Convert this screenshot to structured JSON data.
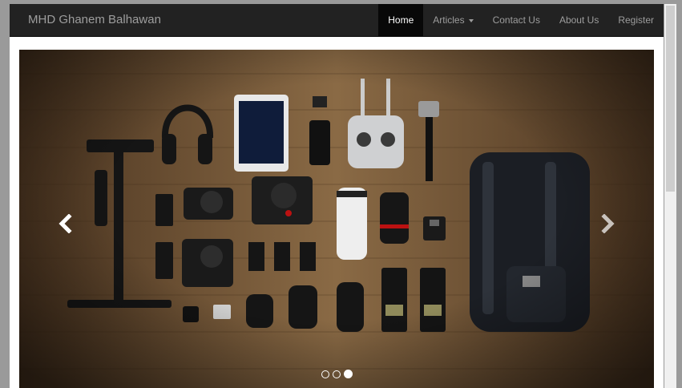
{
  "navbar": {
    "brand": "MHD Ghanem Balhawan",
    "items": [
      {
        "label": "Home",
        "active": true
      },
      {
        "label": "Articles",
        "dropdown": true
      },
      {
        "label": "Contact Us"
      },
      {
        "label": "About Us"
      },
      {
        "label": "Register"
      }
    ]
  },
  "carousel": {
    "slide_image": "flat-lay of camera gear, lenses, drone controller and black backpack on wooden floor",
    "prev_icon": "chevron-left-icon",
    "next_icon": "chevron-right-icon",
    "indicators": 3,
    "active_indicator": 3
  },
  "colors": {
    "navbar_bg": "#222222",
    "nav_text": "#9d9d9d",
    "nav_active_bg": "#080808",
    "page_bg": "#ffffff",
    "frame_bg": "#9a9a9a"
  }
}
